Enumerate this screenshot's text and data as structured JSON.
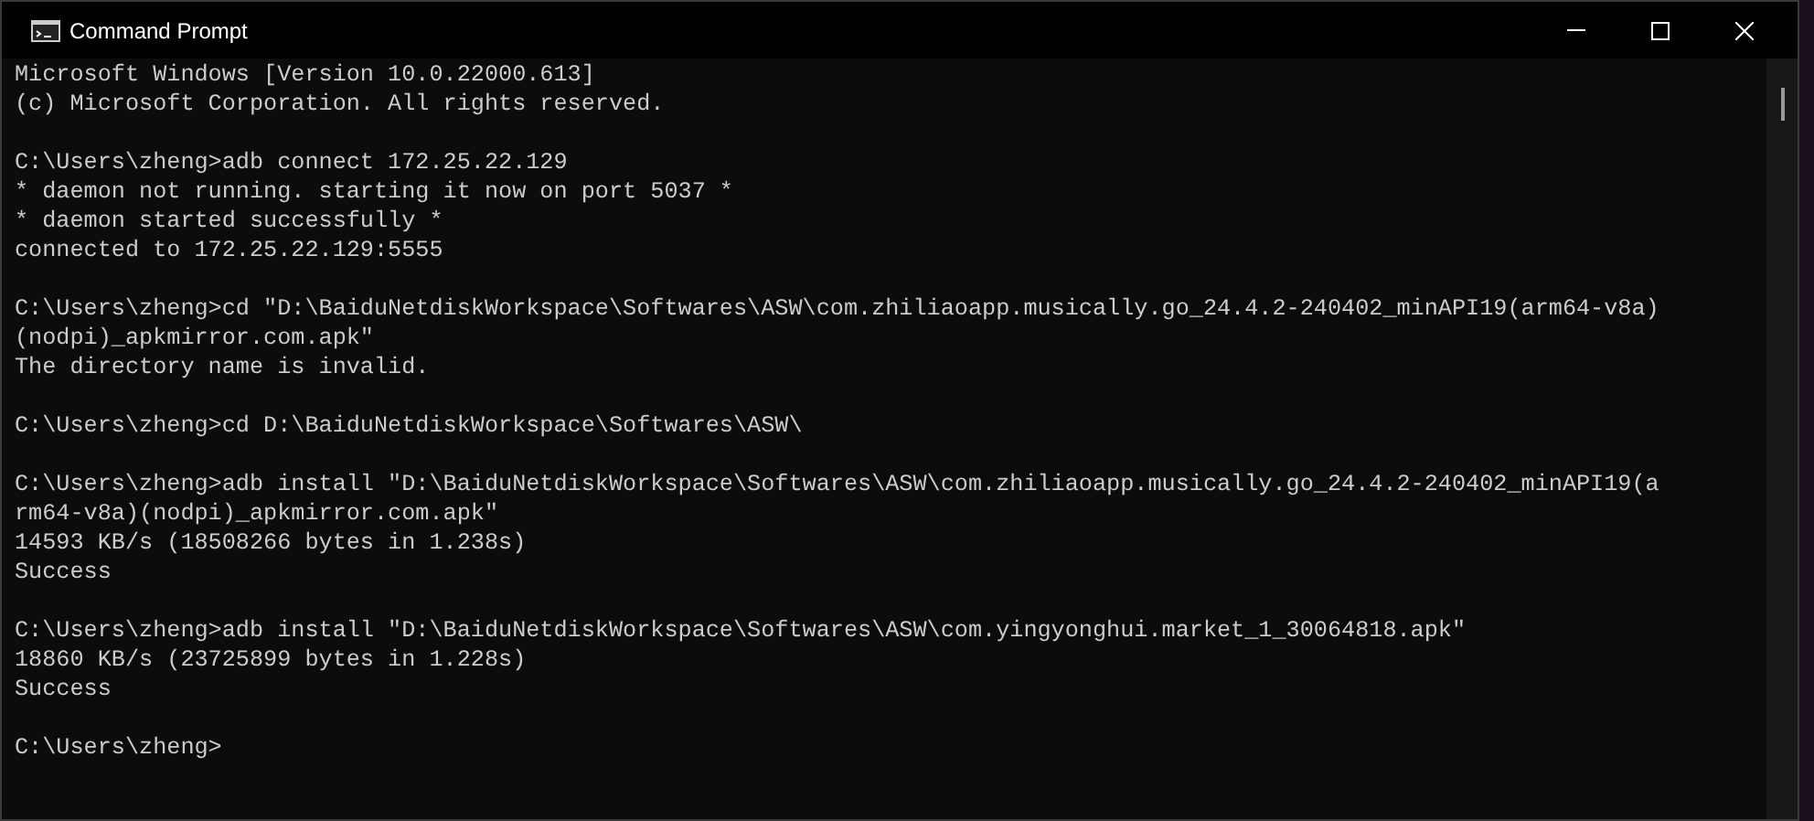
{
  "window": {
    "title": "Command Prompt"
  },
  "console": {
    "blocks": [
      [
        "Microsoft Windows [Version 10.0.22000.613]",
        "(c) Microsoft Corporation. All rights reserved."
      ],
      [
        "C:\\Users\\zheng>adb connect 172.25.22.129",
        "* daemon not running. starting it now on port 5037 *",
        "* daemon started successfully *",
        "connected to 172.25.22.129:5555"
      ],
      [
        "C:\\Users\\zheng>cd \"D:\\BaiduNetdiskWorkspace\\Softwares\\ASW\\com.zhiliaoapp.musically.go_24.4.2-240402_minAPI19(arm64-v8a)",
        "(nodpi)_apkmirror.com.apk\"",
        "The directory name is invalid."
      ],
      [
        "C:\\Users\\zheng>cd D:\\BaiduNetdiskWorkspace\\Softwares\\ASW\\"
      ],
      [
        "C:\\Users\\zheng>adb install \"D:\\BaiduNetdiskWorkspace\\Softwares\\ASW\\com.zhiliaoapp.musically.go_24.4.2-240402_minAPI19(a",
        "rm64-v8a)(nodpi)_apkmirror.com.apk\"",
        "14593 KB/s (18508266 bytes in 1.238s)",
        "Success"
      ],
      [
        "C:\\Users\\zheng>adb install \"D:\\BaiduNetdiskWorkspace\\Softwares\\ASW\\com.yingyonghui.market_1_30064818.apk\"",
        "18860 KB/s (23725899 bytes in 1.228s)",
        "Success"
      ],
      [
        "C:\\Users\\zheng>"
      ]
    ]
  }
}
